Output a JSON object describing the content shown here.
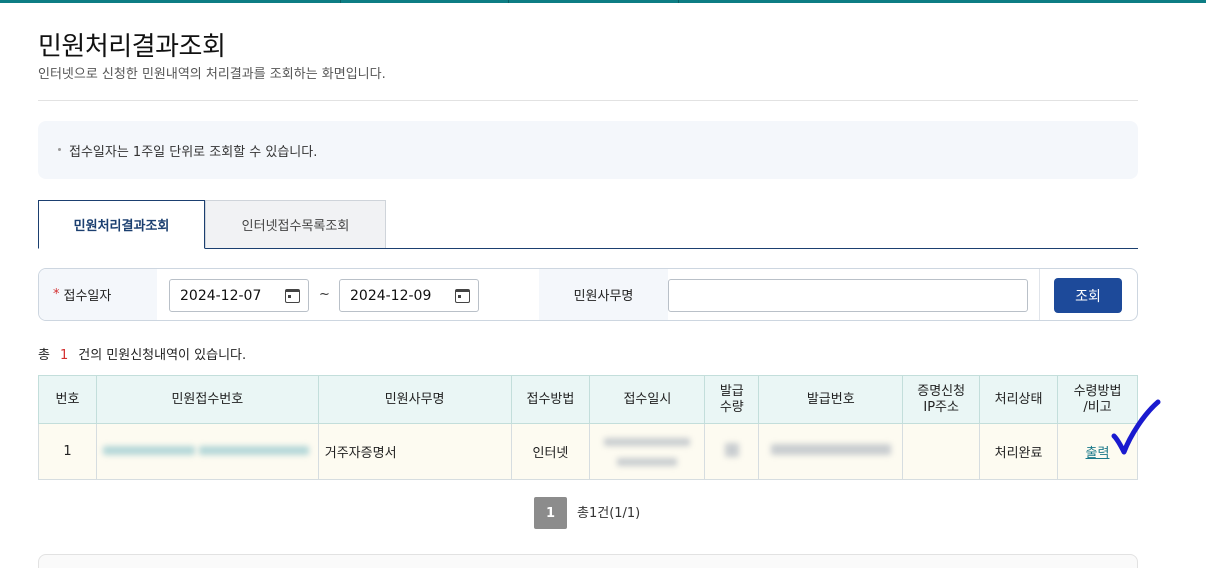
{
  "page": {
    "title": "민원처리결과조회",
    "subtitle": "인터넷으로 신청한 민원내역의 처리결과를 조회하는 화면입니다."
  },
  "notice": {
    "text": "접수일자는 1주일 단위로 조회할 수 있습니다."
  },
  "tabs": [
    {
      "label": "민원처리결과조회",
      "active": true
    },
    {
      "label": "인터넷접수목록조회",
      "active": false
    }
  ],
  "search": {
    "required_mark": "*",
    "date_label": "접수일자",
    "date_from": "2024-12-07",
    "date_to": "2024-12-09",
    "range_separator": "~",
    "name_label": "민원사무명",
    "name_value": "",
    "button_label": "조회"
  },
  "result_count": {
    "prefix": "총",
    "count": "1",
    "suffix": "건의 민원신청내역이 있습니다."
  },
  "table": {
    "headers": [
      "번호",
      "민원접수번호",
      "민원사무명",
      "접수방법",
      "접수일시",
      "발급\n수량",
      "발급번호",
      "증명신청\nIP주소",
      "처리상태",
      "수령방법\n/비고"
    ],
    "rows": [
      {
        "no": "1",
        "receipt_no": "",
        "service_name": "거주자증명서",
        "method": "인터넷",
        "received_at": "",
        "issue_qty": "",
        "issue_no": "",
        "ip_address": "",
        "status": "처리완료",
        "action": "출력"
      }
    ]
  },
  "pagination": {
    "current_page": "1",
    "summary": "총1건(1/1)"
  },
  "colors": {
    "accent": "#1d4a9a",
    "tab_border": "#1b3f70",
    "header_bg": "#eaf6f5",
    "row_bg": "#fdfbf1",
    "required": "#d32f2f",
    "annotation_check": "#1a1acf"
  },
  "annotation": {
    "icon": "checkmark-icon"
  }
}
